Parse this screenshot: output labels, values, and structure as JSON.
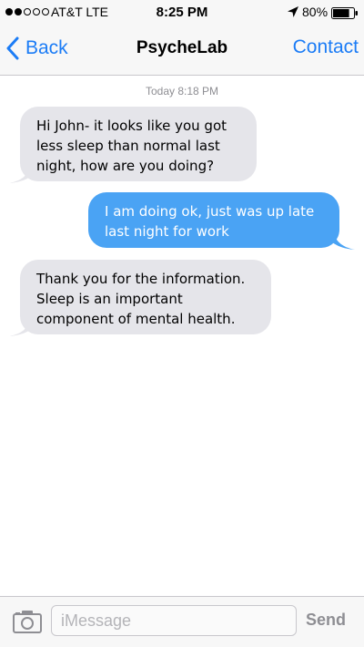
{
  "status_bar": {
    "signal_bars_filled": 2,
    "signal_bars_total": 5,
    "carrier": "AT&T LTE",
    "time": "8:25 PM",
    "battery_percent": "80%",
    "battery_level": 0.8,
    "location_icon": "location-arrow-icon"
  },
  "nav": {
    "back_label": "Back",
    "title": "PsycheLab",
    "contact_label": "Contact",
    "accent_color": "#1b7cf6"
  },
  "conversation": {
    "timestamp": "Today 8:18 PM",
    "messages": [
      {
        "direction": "incoming",
        "text": "Hi John- it looks like you got\nless sleep than normal last\nnight, how are you doing?"
      },
      {
        "direction": "outgoing",
        "text": "I am doing ok, just was up late\nlast night for work"
      },
      {
        "direction": "incoming",
        "text": "Thank you for the information.\nSleep is  an important\ncomponent of mental health."
      }
    ],
    "incoming_color": "#e5e5ea",
    "outgoing_color": "#4aa3f4"
  },
  "input_bar": {
    "camera_icon": "camera-icon",
    "placeholder": "iMessage",
    "value": "",
    "send_label": "Send"
  }
}
